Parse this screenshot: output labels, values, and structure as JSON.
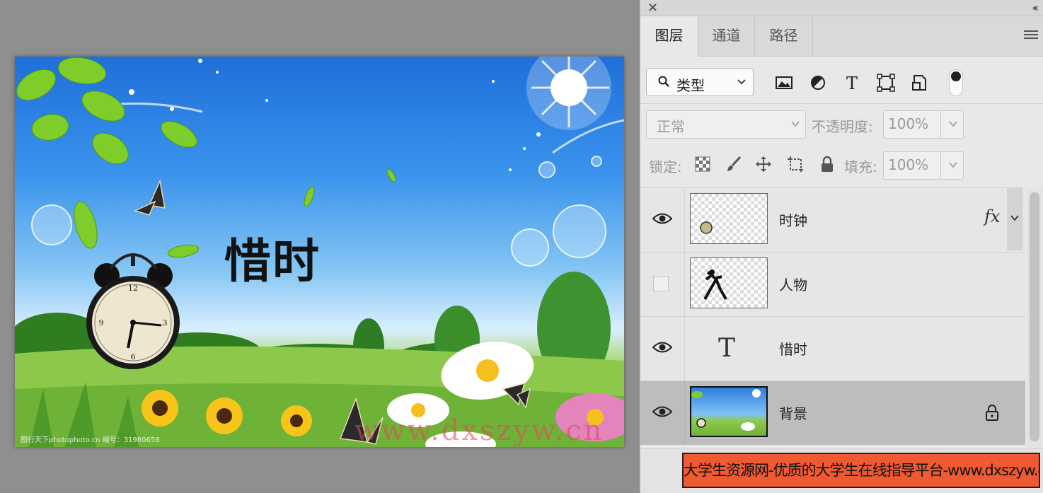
{
  "document": {
    "title_text": "惜时",
    "credit_text": "图行天下photophoto.cn 编号：31980658",
    "watermark_text": "www.dxszyw.cn"
  },
  "panel": {
    "tabs": [
      {
        "label": "图层",
        "active": true
      },
      {
        "label": "通道",
        "active": false
      },
      {
        "label": "路径",
        "active": false
      }
    ],
    "filter": {
      "kind_label": "类型",
      "icons": [
        "image-filter-icon",
        "adjustment-filter-icon",
        "type-filter-icon",
        "shape-filter-icon",
        "smart-object-filter-icon"
      ]
    },
    "blend": {
      "mode": "正常",
      "opacity_label": "不透明度:",
      "opacity_value": "100%"
    },
    "lock": {
      "label": "锁定:",
      "icons": [
        "lock-transparent-pixels-icon",
        "lock-image-pixels-icon",
        "lock-position-icon",
        "lock-artboard-icon",
        "lock-all-icon"
      ],
      "fill_label": "填充:",
      "fill_value": "100%"
    },
    "layers": [
      {
        "name": "时钟",
        "visible": true,
        "kind": "pixel",
        "has_fx": true,
        "fx_label": "fx"
      },
      {
        "name": "人物",
        "visible": false,
        "kind": "pixel"
      },
      {
        "name": "惜时",
        "visible": true,
        "kind": "text",
        "type_glyph": "T"
      },
      {
        "name": "背景",
        "visible": true,
        "kind": "background",
        "locked": true,
        "selected": true
      }
    ]
  },
  "banner": {
    "text": "大学生资源网-优质的大学生在线指导平台-www.dxszyw.cn"
  },
  "colors": {
    "panel_bg": "#e8e8e8",
    "selected_row": "#bdbdbd",
    "banner_bg": "#f05a32",
    "canvas_bg": "#8f8f8f"
  }
}
